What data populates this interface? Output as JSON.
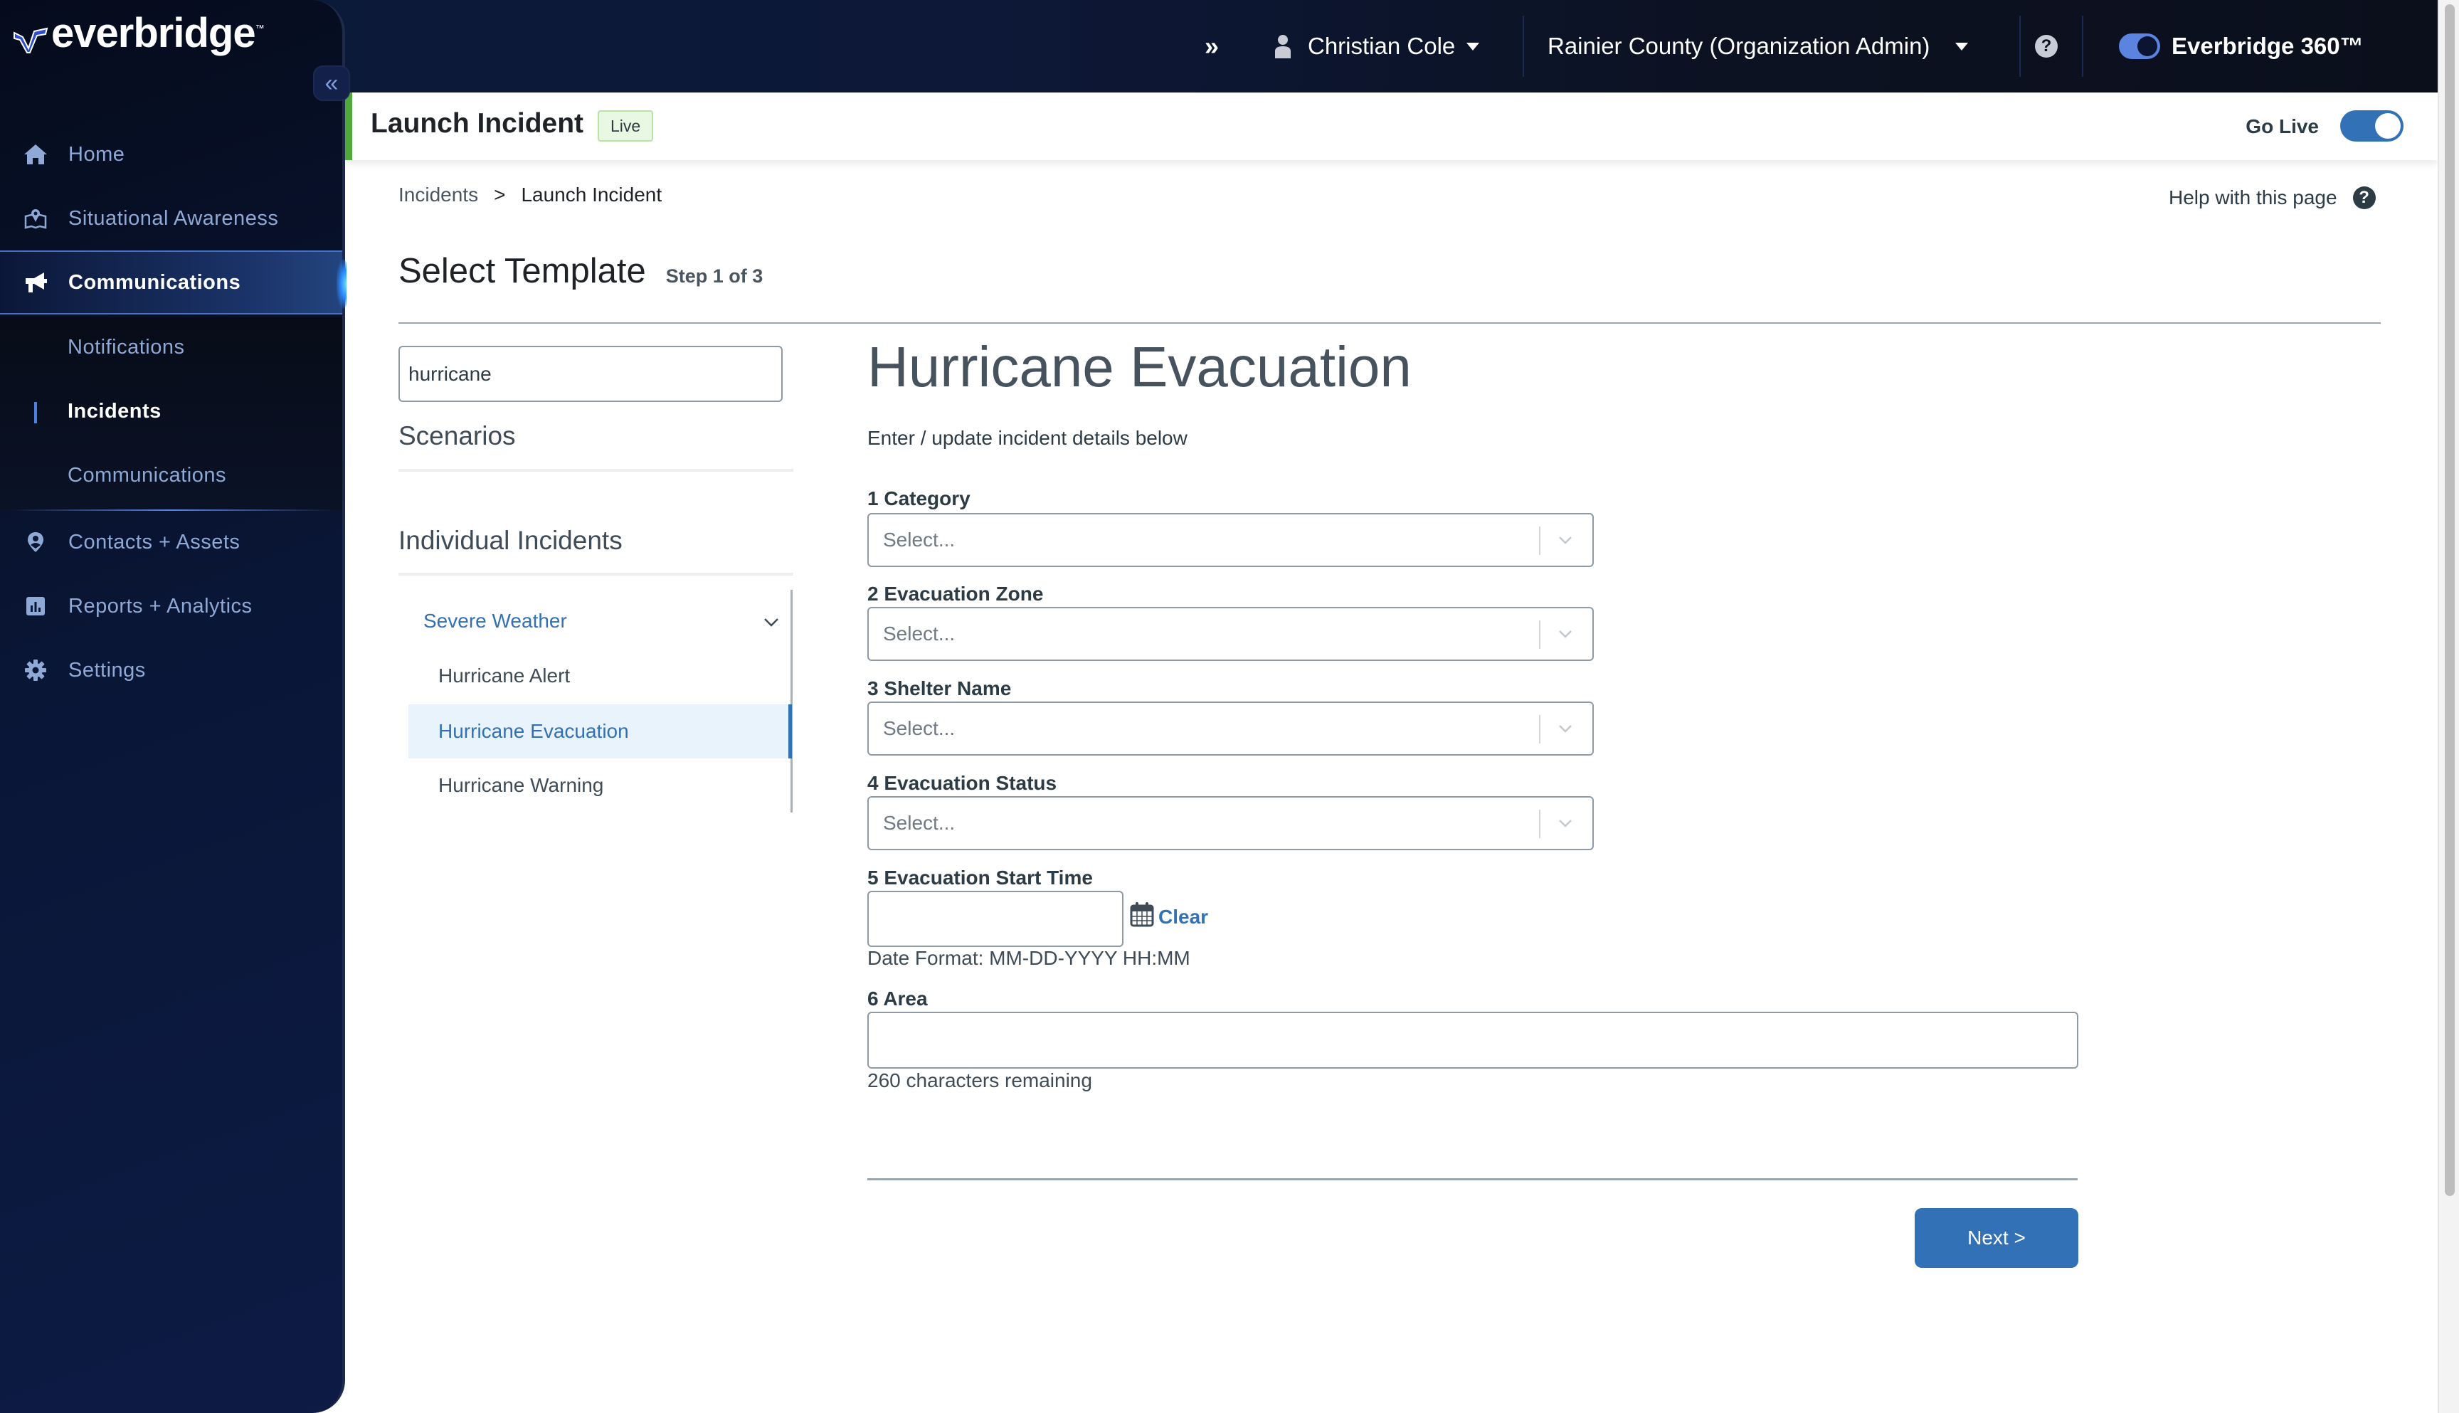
{
  "brand": {
    "logo_text": "everbridge",
    "logo_tm": "™"
  },
  "topbar": {
    "expand_icon": "»",
    "user_name": "Christian Cole",
    "organization": "Rainier County (Organization Admin)",
    "help_icon": "?",
    "product_name": "Everbridge 360™"
  },
  "sidebar": {
    "collapse_icon": "«",
    "items": [
      {
        "label": "Home",
        "icon": "home-icon"
      },
      {
        "label": "Situational Awareness",
        "icon": "map-icon"
      },
      {
        "label": "Communications",
        "icon": "megaphone-icon",
        "active": true
      },
      {
        "label": "Contacts + Assets",
        "icon": "location-person-icon"
      },
      {
        "label": "Reports + Analytics",
        "icon": "bar-chart-icon"
      },
      {
        "label": "Settings",
        "icon": "gear-icon"
      }
    ],
    "subitems": [
      {
        "label": "Notifications"
      },
      {
        "label": "Incidents",
        "active": true
      },
      {
        "label": "Communications"
      }
    ]
  },
  "header": {
    "title": "Launch Incident",
    "badge": "Live",
    "go_live_label": "Go Live",
    "go_live_on": true
  },
  "breadcrumb": {
    "items": [
      "Incidents",
      "Launch Incident"
    ],
    "separator": ">"
  },
  "help": {
    "label": "Help with this page",
    "icon": "?"
  },
  "section": {
    "title": "Select Template",
    "step": "Step 1 of 3"
  },
  "template_list": {
    "search_value": "hurricane",
    "groups": [
      "Scenarios",
      "Individual Incidents"
    ],
    "category": "Severe Weather",
    "templates": [
      {
        "label": "Hurricane Alert"
      },
      {
        "label": "Hurricane Evacuation",
        "selected": true
      },
      {
        "label": "Hurricane Warning"
      }
    ]
  },
  "form": {
    "title": "Hurricane Evacuation",
    "subtitle": "Enter / update incident details below",
    "fields": [
      {
        "label": "1 Category",
        "placeholder": "Select..."
      },
      {
        "label": "2 Evacuation Zone",
        "placeholder": "Select..."
      },
      {
        "label": "3 Shelter Name",
        "placeholder": "Select..."
      },
      {
        "label": "4 Evacuation Status",
        "placeholder": "Select..."
      }
    ],
    "start_time": {
      "label": "5 Evacuation Start Time",
      "value": "",
      "clear_label": "Clear",
      "format_hint": "Date Format: MM-DD-YYYY HH:MM"
    },
    "area": {
      "label": "6 Area",
      "value": "",
      "remaining": "260 characters remaining"
    },
    "next_label": "Next >"
  },
  "colors": {
    "accent": "#3271b5",
    "live_green": "#4fa83a",
    "sidebar_bg": "#0a1636"
  }
}
